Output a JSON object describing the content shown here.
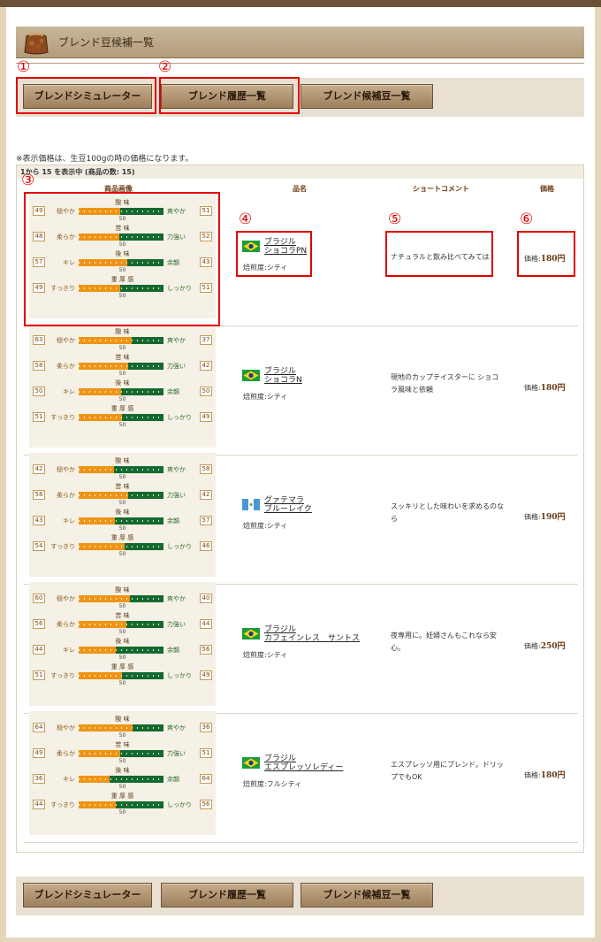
{
  "header": {
    "title": "ブレンド豆候補一覧"
  },
  "markers": [
    "①",
    "②",
    "③",
    "④",
    "⑤",
    "⑥"
  ],
  "buttons": [
    "ブレンドシミュレーター",
    "ブレンド履歴一覧",
    "ブレンド候補豆一覧"
  ],
  "note": "※表示価格は、生豆100gの時の価格になります。",
  "count_text": "1から 15 を表示中 (商品の数: 15)",
  "columns": [
    "商品画像",
    "品名",
    "ショートコメント",
    "価格"
  ],
  "price_prefix": "価格:",
  "scale_mid": "50",
  "axes": [
    {
      "title": "酸 味",
      "left": "穏やか",
      "right": "爽やか"
    },
    {
      "title": "苦 味",
      "left": "柔らか",
      "right": "力強い"
    },
    {
      "title": "後 味",
      "left": "キレ",
      "right": "余韻"
    },
    {
      "title": "重 厚 感",
      "left": "すっきり",
      "right": "しっかり"
    }
  ],
  "products": [
    {
      "name_line1": "ブラジル",
      "name_line2": "ショコラPN",
      "flag": "brazil-flag-icon",
      "roast": "焙煎度:シティ",
      "comment": "ナチュラルと飲み比べてみては",
      "price": "180円",
      "values": [
        [
          49,
          51
        ],
        [
          48,
          52
        ],
        [
          57,
          43
        ],
        [
          49,
          51
        ]
      ]
    },
    {
      "name_line1": "ブラジル",
      "name_line2": "ショコラN",
      "flag": "brazil-flag-icon",
      "roast": "焙煎度:シティ",
      "comment": "現地のカップテイスターに ショコラ風味と依頼",
      "price": "180円",
      "values": [
        [
          63,
          37
        ],
        [
          58,
          42
        ],
        [
          50,
          50
        ],
        [
          51,
          49
        ]
      ]
    },
    {
      "name_line1": "グァテマラ",
      "name_line2": "ブルーレイク",
      "flag": "guatemala-flag-icon",
      "roast": "焙煎度:シティ",
      "comment": "スッキリとした味わいを求めるのなら",
      "price": "190円",
      "values": [
        [
          42,
          58
        ],
        [
          58,
          42
        ],
        [
          43,
          57
        ],
        [
          54,
          46
        ]
      ]
    },
    {
      "name_line1": "ブラジル",
      "name_line2": "カフェインレス　サントス",
      "flag": "brazil-flag-icon",
      "roast": "焙煎度:シティ",
      "comment": "夜専用に。妊婦さんもこれなら安心。",
      "price": "250円",
      "values": [
        [
          60,
          40
        ],
        [
          56,
          44
        ],
        [
          44,
          56
        ],
        [
          51,
          49
        ]
      ]
    },
    {
      "name_line1": "ブラジル",
      "name_line2": "エスプレッソレディー",
      "flag": "brazil-flag-icon",
      "roast": "焙煎度:フルシティ",
      "comment": "エスプレッソ用にブレンド。ドリップでもOK",
      "price": "180円",
      "values": [
        [
          64,
          36
        ],
        [
          49,
          51
        ],
        [
          36,
          64
        ],
        [
          44,
          56
        ]
      ]
    }
  ],
  "colors": {
    "acid_fill": "#ef9414",
    "track": "#146a2e",
    "marker": "#e20000"
  }
}
